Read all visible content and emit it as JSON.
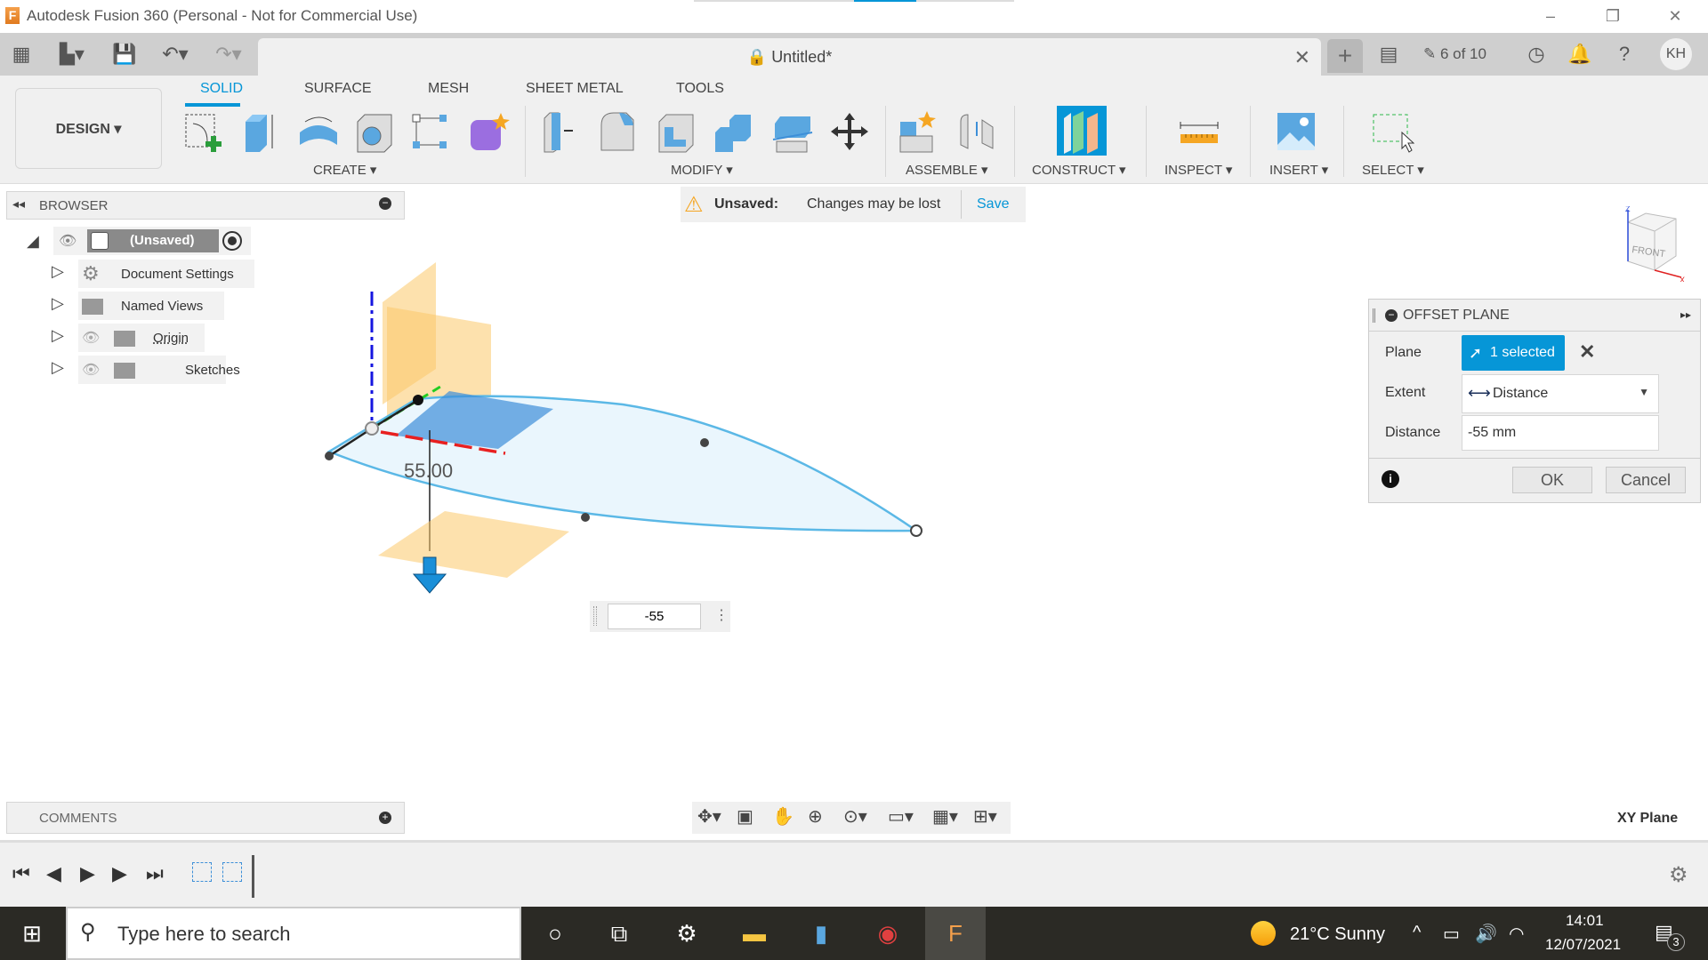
{
  "window": {
    "title": "Autodesk Fusion 360 (Personal - Not for Commercial Use)",
    "minimize": "–",
    "restore": "❐",
    "close": "✕"
  },
  "appbar": {
    "doc_title": "Untitled*",
    "new_tab": "+",
    "version_count": "6 of 10",
    "user_initials": "KH"
  },
  "ribbon": {
    "workspace": "DESIGN ▾",
    "tabs": [
      "SOLID",
      "SURFACE",
      "MESH",
      "SHEET METAL",
      "TOOLS"
    ],
    "active_tab": "SOLID",
    "groups": [
      "CREATE ▾",
      "MODIFY ▾",
      "ASSEMBLE ▾",
      "CONSTRUCT ▾",
      "INSPECT ▾",
      "INSERT ▾",
      "SELECT ▾"
    ]
  },
  "browser": {
    "title": "BROWSER",
    "root": "(Unsaved)",
    "items": [
      {
        "label": "Document Settings",
        "icon": "gear-icon"
      },
      {
        "label": "Named Views",
        "icon": "folder-icon"
      },
      {
        "label": "Origin",
        "icon": "folder-icon"
      },
      {
        "label": "Sketches",
        "icon": "folder-icon"
      }
    ]
  },
  "notice": {
    "status": "Unsaved:",
    "message": "Changes may be lost",
    "action": "Save"
  },
  "viewport": {
    "dimension_label": "55.00",
    "value_input": "-55",
    "viewcube_face": "FRONT",
    "axis_z": "Z",
    "axis_x": "X"
  },
  "dialog": {
    "title": "OFFSET PLANE",
    "plane_label": "Plane",
    "plane_value": "1 selected",
    "extent_label": "Extent",
    "extent_value": "Distance",
    "distance_label": "Distance",
    "distance_value": "-55 mm",
    "ok": "OK",
    "cancel": "Cancel"
  },
  "comments": {
    "title": "COMMENTS"
  },
  "status": {
    "selection": "XY Plane"
  },
  "taskbar": {
    "search_placeholder": "Type here to search",
    "weather": "21°C  Sunny",
    "time": "14:01",
    "date": "12/07/2021",
    "notifications": "3"
  }
}
